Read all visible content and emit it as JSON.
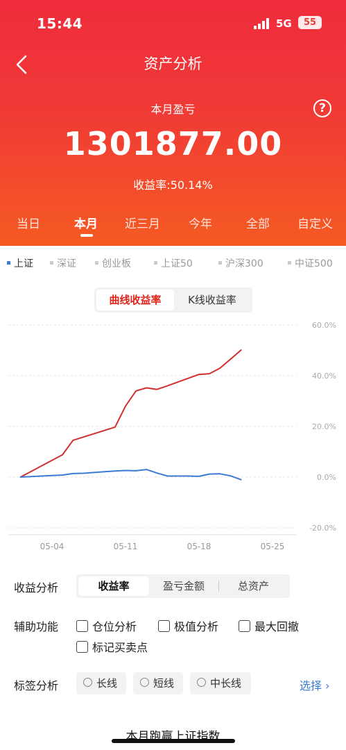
{
  "status": {
    "time": "15:44",
    "network": "5G",
    "battery": "55"
  },
  "header": {
    "title": "资产分析"
  },
  "summary": {
    "label": "本月盈亏",
    "amount": "1301877.00",
    "yield_label": "收益率:",
    "yield_value": "50.14%"
  },
  "period_tabs": [
    "当日",
    "本月",
    "近三月",
    "今年",
    "全部",
    "自定义"
  ],
  "period_active": "本月",
  "indices": [
    "上证",
    "深证",
    "创业板",
    "上证50",
    "沪深300",
    "中证500"
  ],
  "index_active": "上证",
  "chart_modes": [
    "曲线收益率",
    "K线收益率"
  ],
  "chart_mode_active": "曲线收益率",
  "chart_data": {
    "type": "line",
    "x_ticks": [
      "05-04",
      "05-11",
      "05-18",
      "05-25"
    ],
    "y_ticks": [
      "60.0%",
      "40.0%",
      "20.0%",
      "0.0%",
      "-20.0%"
    ],
    "ylim": [
      -20,
      60
    ],
    "grid": true,
    "colors": {
      "portfolio": "#d32f2f",
      "index": "#3a7bd5"
    },
    "series": [
      {
        "key": "portfolio",
        "x": [
          "05-01",
          "05-02",
          "05-03",
          "05-04",
          "05-05",
          "05-06",
          "05-07",
          "05-08",
          "05-09",
          "05-10",
          "05-11",
          "05-12",
          "05-13",
          "05-14",
          "05-15",
          "05-16",
          "05-17",
          "05-18",
          "05-19",
          "05-20",
          "05-21",
          "05-22"
        ],
        "values": [
          0,
          2.2,
          4.4,
          6.6,
          8.8,
          14.5,
          15.8,
          17.1,
          18.4,
          19.7,
          28,
          34,
          35.2,
          34.6,
          36,
          37.5,
          39,
          40.5,
          40.8,
          43,
          46.5,
          50.1
        ]
      },
      {
        "key": "index",
        "x": [
          "05-01",
          "05-02",
          "05-03",
          "05-04",
          "05-05",
          "05-06",
          "05-07",
          "05-08",
          "05-09",
          "05-10",
          "05-11",
          "05-12",
          "05-13",
          "05-14",
          "05-15",
          "05-16",
          "05-17",
          "05-18",
          "05-19",
          "05-20",
          "05-21",
          "05-22"
        ],
        "values": [
          0,
          0.2,
          0.4,
          0.6,
          0.8,
          1.4,
          1.5,
          1.8,
          2.1,
          2.4,
          2.6,
          2.5,
          3,
          1.6,
          0.4,
          0.4,
          0.4,
          0.3,
          1.2,
          1.3,
          0.5,
          -1
        ]
      }
    ]
  },
  "analysis": {
    "label": "收益分析",
    "options": [
      "收益率",
      "盈亏金额",
      "总资产"
    ],
    "active": "收益率"
  },
  "aux": {
    "label": "辅助功能",
    "options": [
      "仓位分析",
      "极值分析",
      "最大回撤",
      "标记买卖点"
    ]
  },
  "tags": {
    "label": "标签分析",
    "options": [
      "长线",
      "短线",
      "中长线"
    ],
    "select_label": "选择 ›"
  },
  "footer": {
    "text": "本月跑赢上证指数"
  }
}
